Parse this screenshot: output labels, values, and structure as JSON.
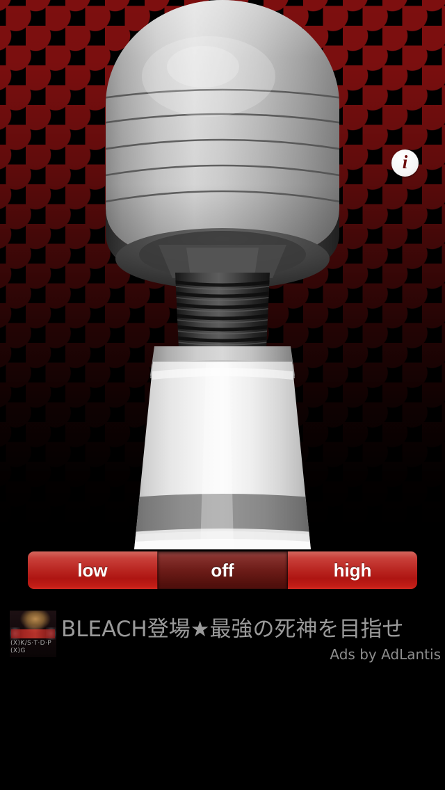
{
  "app": {
    "background_color": "#000000",
    "dot_color": "#7d0f0f"
  },
  "info_button": {
    "name": "info",
    "glyph": "i",
    "icon": "info-icon",
    "circle_color": "#ffffff",
    "glyph_color": "#6b0d0d"
  },
  "device": {
    "name": "massager-wand",
    "head_color": "#b9b9b9",
    "neck_color": "#3a3a3a",
    "body_color": "#f0f0f0",
    "band_color": "#8c8c8c"
  },
  "speed_control": {
    "name": "speed-selector",
    "selected": "off",
    "accent_color": "#b8241f",
    "selected_color": "#5c1410",
    "options": [
      {
        "id": "low",
        "label": "low",
        "selected": false
      },
      {
        "id": "off",
        "label": "off",
        "selected": true
      },
      {
        "id": "high",
        "label": "high",
        "selected": false
      }
    ]
  },
  "ad": {
    "headline": "BLEACH登場★最強の死神を目指せ",
    "attribution": "Ads by AdLantis",
    "thumbnail_caption": "(X)K/S·T·D·P (X)G",
    "text_color": "#9a9a9a"
  }
}
